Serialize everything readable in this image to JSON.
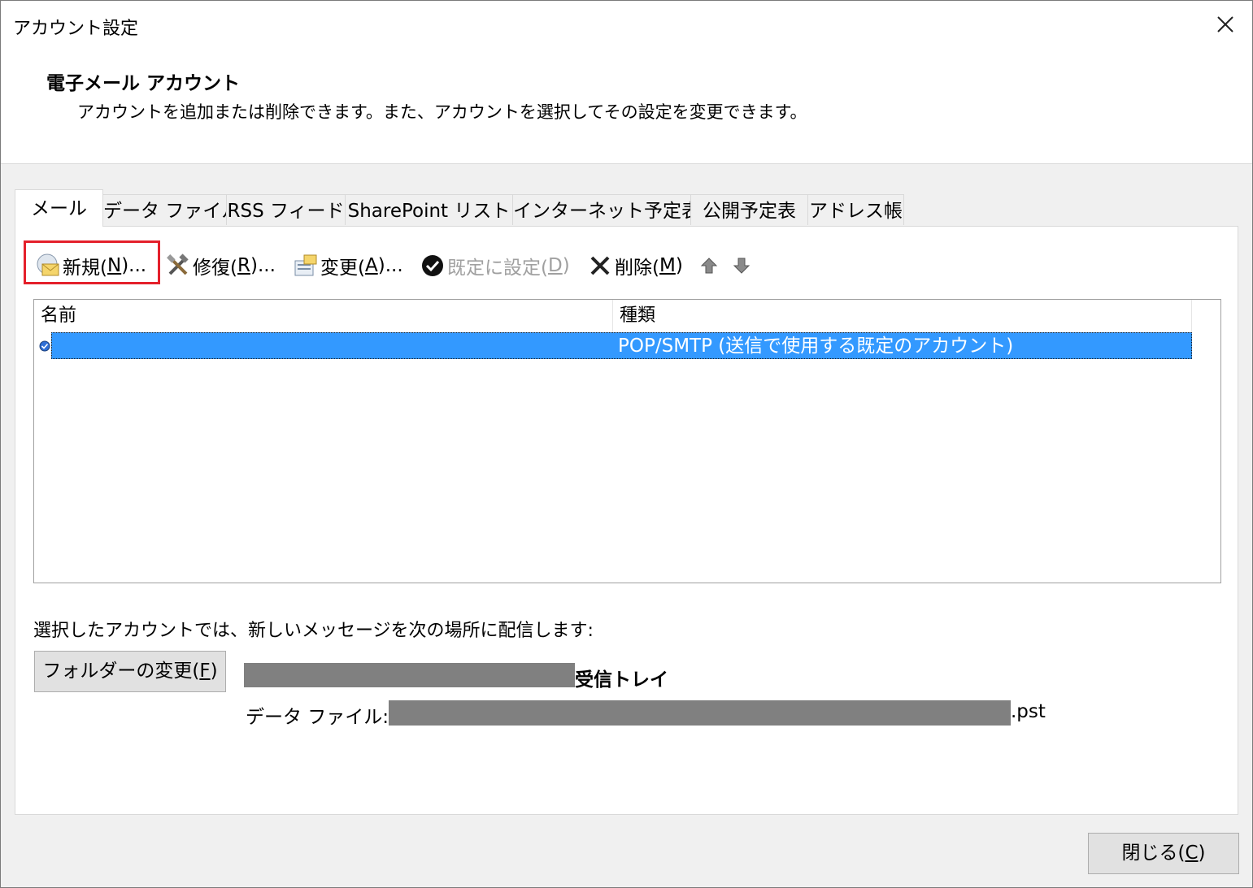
{
  "window": {
    "title": "アカウント設定"
  },
  "header": {
    "heading": "電子メール アカウント",
    "description": "アカウントを追加または削除できます。また、アカウントを選択してその設定を変更できます。"
  },
  "tabs": [
    {
      "label": "メール",
      "active": true
    },
    {
      "label": "データ ファイル",
      "active": false
    },
    {
      "label": "RSS フィード",
      "active": false
    },
    {
      "label": "SharePoint リスト",
      "active": false
    },
    {
      "label": "インターネット予定表",
      "active": false
    },
    {
      "label": "公開予定表",
      "active": false
    },
    {
      "label": "アドレス帳",
      "active": false
    }
  ],
  "toolbar": {
    "new": {
      "pre": "新規(",
      "key": "N",
      "post": ")..."
    },
    "repair": {
      "pre": "修復(",
      "key": "R",
      "post": ")..."
    },
    "change": {
      "pre": "変更(",
      "key": "A",
      "post": ")..."
    },
    "set_default": {
      "pre": "既定に設定(",
      "key": "D",
      "post": ")"
    },
    "remove": {
      "pre": "削除(",
      "key": "M",
      "post": ")"
    }
  },
  "account_list": {
    "columns": [
      "名前",
      "種類"
    ],
    "rows": [
      {
        "name": "",
        "type": "POP/SMTP (送信で使用する既定のアカウント)",
        "selected": true
      }
    ]
  },
  "delivery": {
    "info": "選択したアカウントでは、新しいメッセージを次の場所に配信します:",
    "change_folder": {
      "pre": "フォルダーの変更(",
      "key": "F",
      "post": ")"
    },
    "folder_suffix": "受信トレイ",
    "data_file_prefix": "データ ファイル: C:",
    "data_file_ext": ".pst"
  },
  "footer": {
    "close": {
      "pre": "閉じる(",
      "key": "C",
      "post": ")"
    }
  },
  "colors": {
    "selection": "#3399ff",
    "highlight_border": "#e4202b",
    "redacted": "#808080"
  }
}
